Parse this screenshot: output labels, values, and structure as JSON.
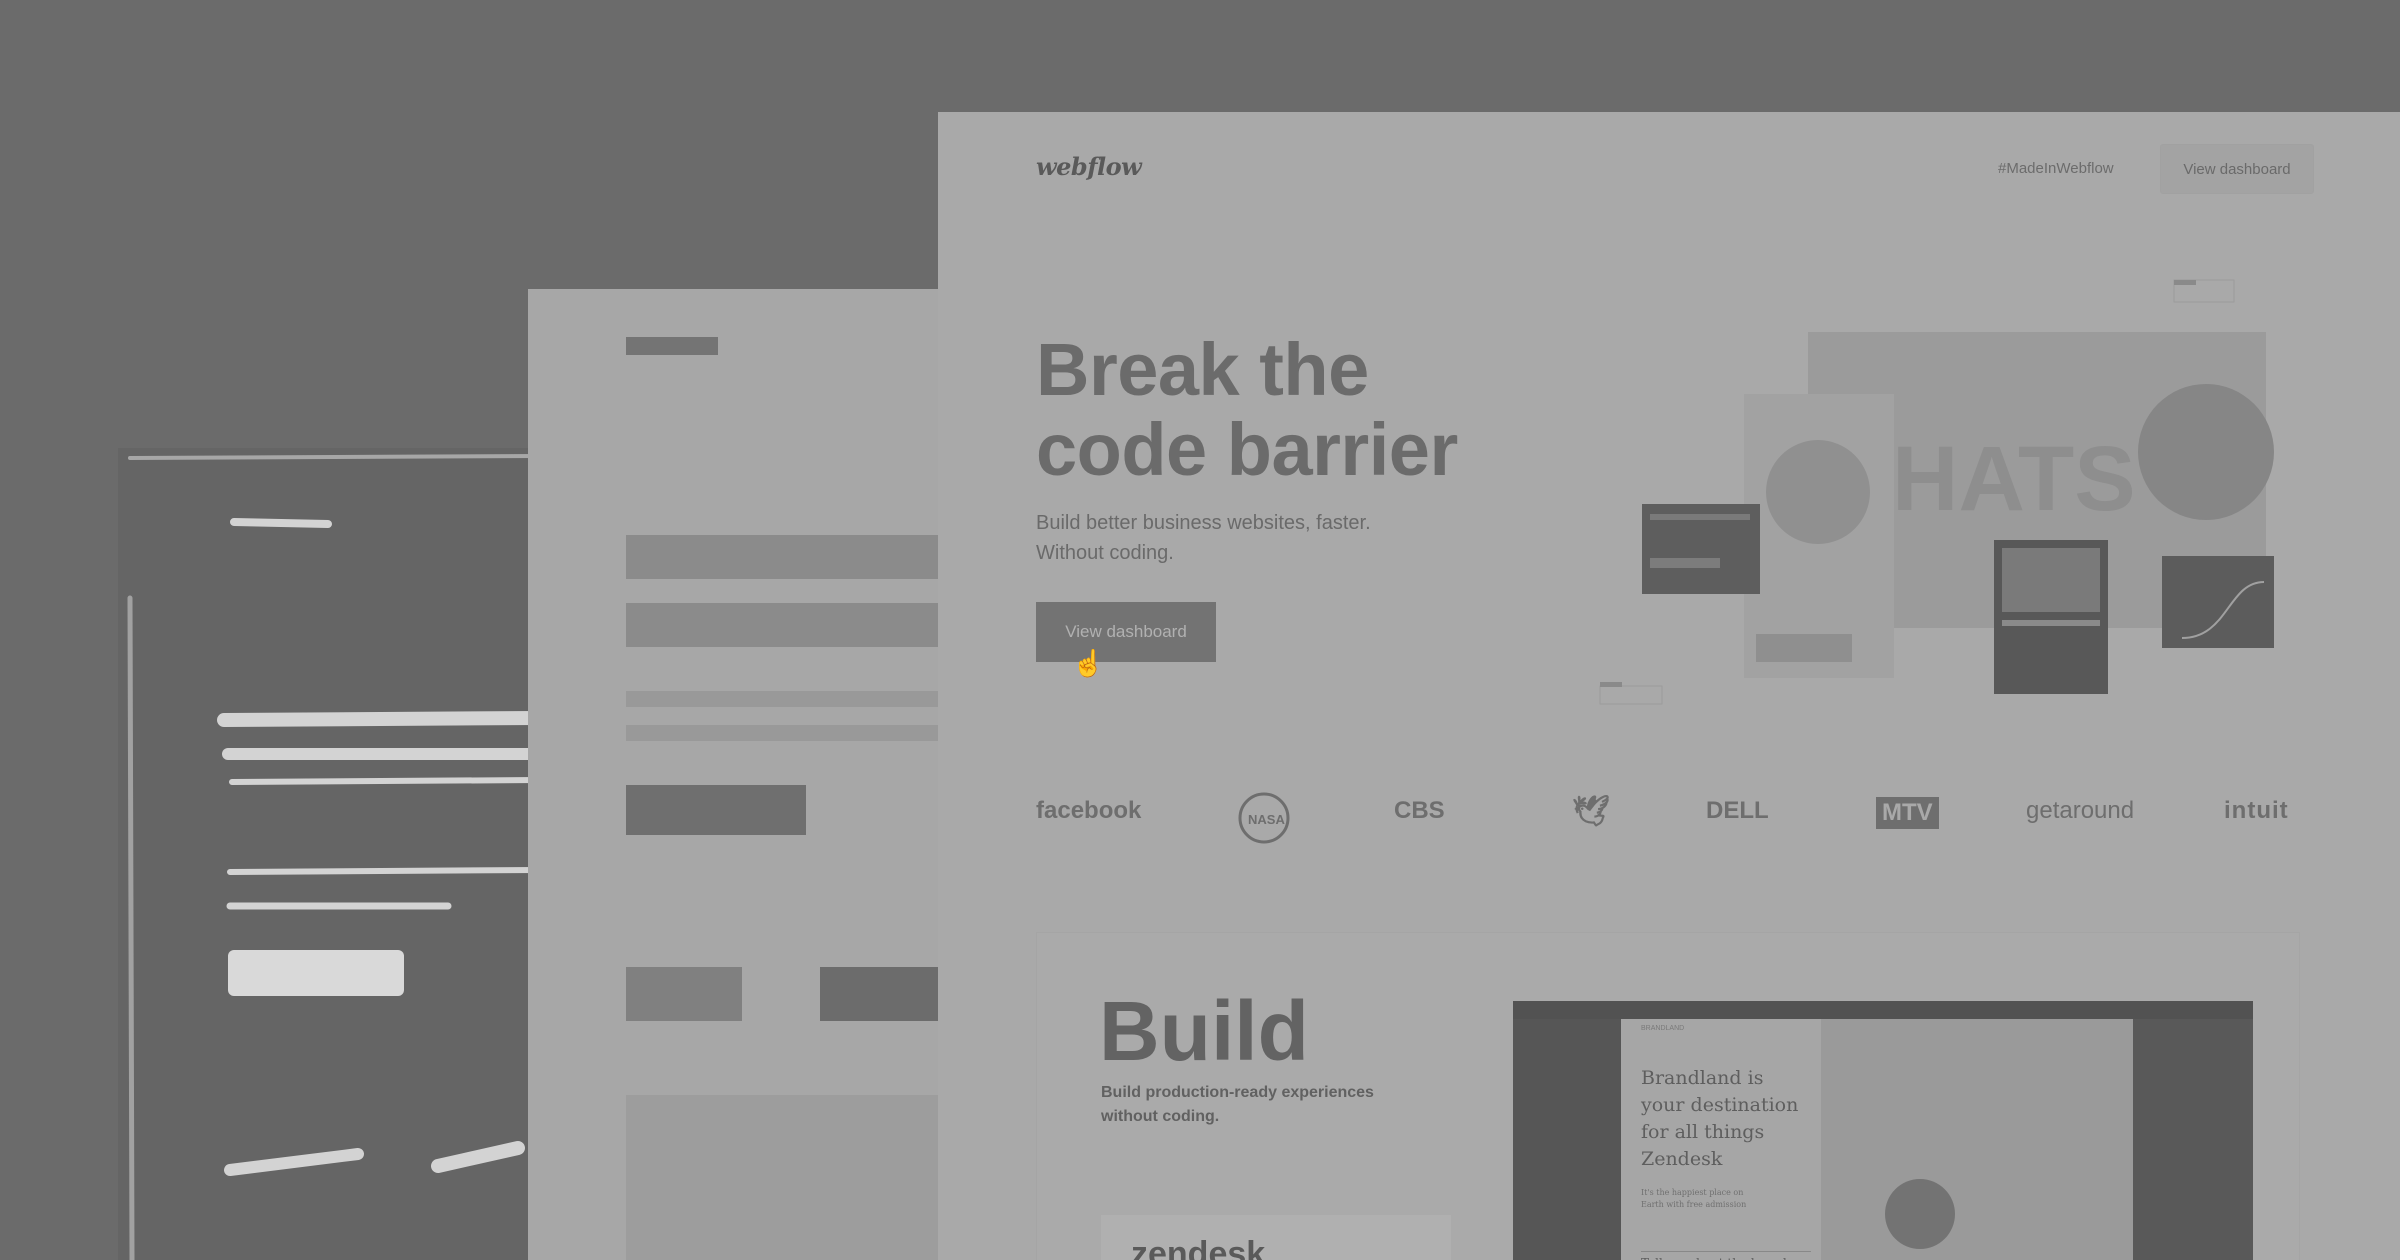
{
  "main": {
    "brand": "webflow",
    "nav_link": "#MadeInWebflow",
    "nav_button": "View dashboard",
    "headline_line1": "Break the",
    "headline_line2": "code barrier",
    "subline_line1": "Build better business websites, faster.",
    "subline_line2": "Without coding.",
    "cta": "View dashboard",
    "cursor_icon": "hand-pointer-icon"
  },
  "collage": {
    "hats_text": "HATS"
  },
  "logos": [
    "facebook",
    "NASA",
    "CBS",
    "twitter",
    "DELL",
    "MTV",
    "getaround",
    "intuit"
  ],
  "build": {
    "title": "Build",
    "sub_line1": "Build production-ready experiences",
    "sub_line2": "without coding.",
    "card_text": "zendesk",
    "editor": {
      "label": "BRANDLAND",
      "heading_l1": "Brandland is",
      "heading_l2": "your destination",
      "heading_l3": "for all things",
      "heading_l4": "Zendesk",
      "small_l1": "It's the happiest place on",
      "small_l2": "Earth with free admission",
      "input": "Tell me about the brand"
    }
  },
  "colors": {
    "background": "#6b6b6b",
    "overlay_tone": "grayscale"
  }
}
